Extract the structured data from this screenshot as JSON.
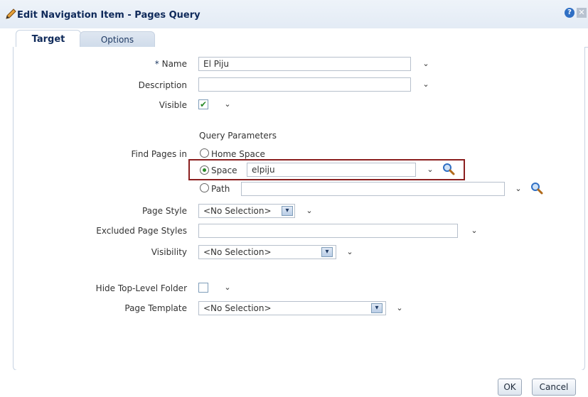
{
  "dialog": {
    "title": "Edit Navigation Item - Pages Query",
    "help_glyph": "?",
    "close_glyph": "✕"
  },
  "tabs": [
    {
      "label": "Target",
      "active": true
    },
    {
      "label": "Options",
      "active": false
    }
  ],
  "form": {
    "name": {
      "required_mark": "*",
      "label": "Name",
      "value": "El Piju"
    },
    "description": {
      "label": "Description",
      "value": ""
    },
    "visible": {
      "label": "Visible",
      "checked": true,
      "check_glyph": "✔"
    },
    "query_parameters_heading": "Query Parameters",
    "find_pages_in": {
      "label": "Find Pages in",
      "options": [
        {
          "label": "Home Space",
          "selected": false
        },
        {
          "label": "Space",
          "selected": true,
          "value": "elpiju"
        },
        {
          "label": "Path",
          "selected": false,
          "value": ""
        }
      ]
    },
    "page_style": {
      "label": "Page Style",
      "value": "<No Selection>"
    },
    "excluded_page_styles": {
      "label": "Excluded Page Styles",
      "value": ""
    },
    "visibility": {
      "label": "Visibility",
      "value": "<No Selection>"
    },
    "hide_top_level_folder": {
      "label": "Hide Top-Level Folder",
      "checked": false
    },
    "page_template": {
      "label": "Page Template",
      "value": "<No Selection>"
    }
  },
  "buttons": {
    "ok": "OK",
    "cancel": "Cancel"
  },
  "glyphs": {
    "chevron": "⌄",
    "select_arrow": "▾"
  },
  "colors": {
    "highlight_border": "#8b1f1f",
    "title_text": "#0f2a5a",
    "check_green": "#2a8a2a"
  }
}
